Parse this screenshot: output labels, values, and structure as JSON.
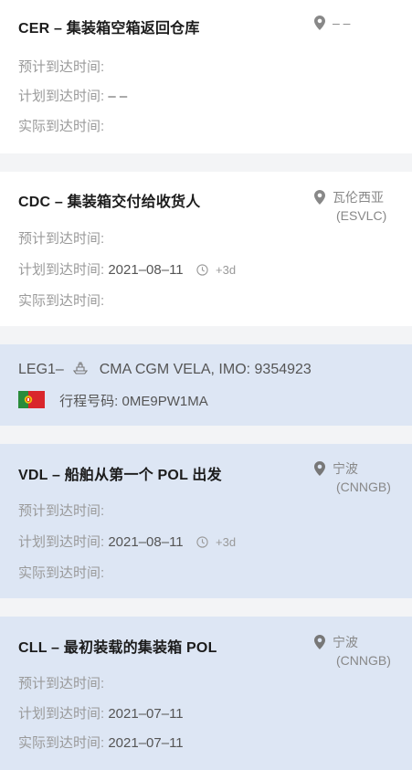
{
  "labels": {
    "estimated": "预计到达时间:",
    "planned": "计划到达时间:",
    "actual": "实际到达时间:"
  },
  "events": [
    {
      "title": "CER – 集装箱空箱返回仓库",
      "location_name": "– –",
      "location_code": "",
      "planned": "– –",
      "planned_offset": "",
      "actual": ""
    },
    {
      "title": "CDC – 集装箱交付给收货人",
      "location_name": "瓦伦西亚",
      "location_code": "(ESVLC)",
      "planned": "2021–08–11",
      "planned_offset": "+3d",
      "actual": ""
    },
    {
      "title": "VDL – 船舶从第一个 POL 出发",
      "location_name": "宁波",
      "location_code": "(CNNGB)",
      "planned": "2021–08–11",
      "planned_offset": "+3d",
      "actual": ""
    },
    {
      "title": "CLL – 最初装载的集装箱 POL",
      "location_name": "宁波",
      "location_code": "(CNNGB)",
      "planned": "2021–07–11",
      "planned_offset": "",
      "actual": "2021–07–11"
    }
  ],
  "leg": {
    "prefix": "LEG1–",
    "vessel": "CMA CGM VELA, IMO: 9354923",
    "trip_label": "行程号码:",
    "trip_number": "0ME9PW1MA",
    "ship_icon": "ship-icon",
    "flag_icon": "portugal-flag-icon"
  },
  "colors": {
    "white_card": "#ffffff",
    "blue_card": "#dde6f4",
    "gap": "#f3f4f6"
  }
}
